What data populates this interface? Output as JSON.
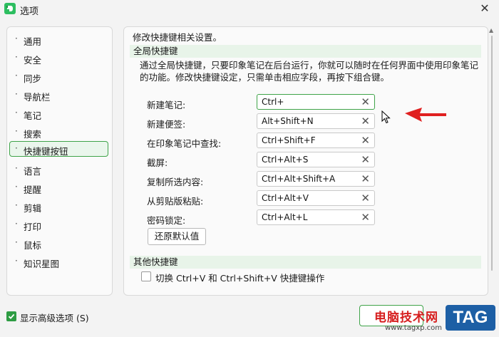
{
  "window": {
    "title": "选项",
    "close_glyph": "✕",
    "icon": "evernote-elephant-icon",
    "accent_color": "#3fa349"
  },
  "sidebar": {
    "items": [
      {
        "label": "通用"
      },
      {
        "label": "安全"
      },
      {
        "label": "同步"
      },
      {
        "label": "导航栏"
      },
      {
        "label": "笔记"
      },
      {
        "label": "搜索"
      },
      {
        "label": "快捷键按钮",
        "active": true
      },
      {
        "label": "语言"
      },
      {
        "label": "提醒"
      },
      {
        "label": "剪辑"
      },
      {
        "label": "打印"
      },
      {
        "label": "鼠标"
      },
      {
        "label": "知识星图"
      }
    ]
  },
  "main": {
    "heading": "修改快捷键相关设置。",
    "global": {
      "title": "全局快捷键",
      "description": "通过全局快捷键，只要印象笔记在后台运行，你就可以随时在任何界面中使用印象笔记的功能。修改快捷键设定，只需单击相应字段，再按下组合键。"
    },
    "shortcuts": [
      {
        "label": "新建笔记:",
        "value": "Ctrl+"
      },
      {
        "label": "新建便签:",
        "value": "Alt+Shift+N"
      },
      {
        "label": "在印象笔记中查找:",
        "value": "Ctrl+Shift+F"
      },
      {
        "label": "截屏:",
        "value": "Ctrl+Alt+S"
      },
      {
        "label": "复制所选内容:",
        "value": "Ctrl+Alt+Shift+A"
      },
      {
        "label": "从剪贴版粘贴:",
        "value": "Ctrl+Alt+V"
      },
      {
        "label": "密码锁定:",
        "value": "Ctrl+Alt+L"
      }
    ],
    "clear_glyph": "✕",
    "reset_label": "还原默认值",
    "other": {
      "title": "其他快捷键",
      "toggle_label": "切换 Ctrl+V 和 Ctrl+Shift+V 快捷键操作",
      "checked": false
    }
  },
  "footer": {
    "advanced_label": "显示高级选项 (S)",
    "advanced_checked": true
  },
  "watermark": {
    "text": "电脑技术网",
    "url": "www.tagxp.com",
    "badge": "TAG"
  }
}
